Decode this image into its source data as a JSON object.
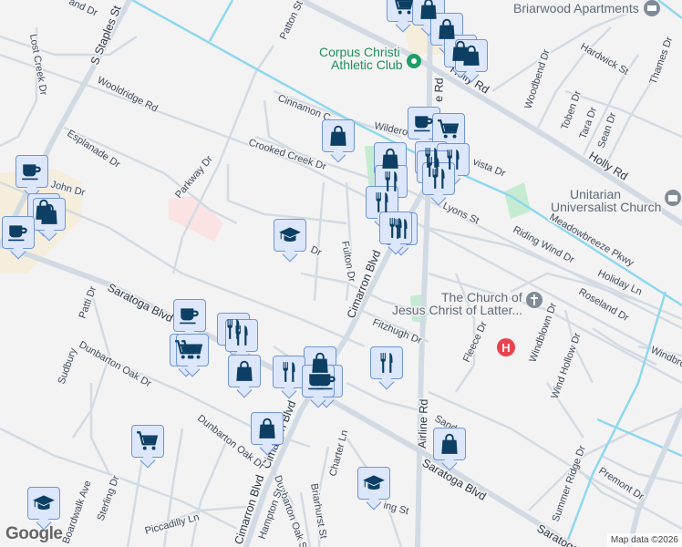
{
  "map": {
    "streets": {
      "s_staples": "S Staples St",
      "lost_creek": "Lost Creek Dr",
      "wooldridge": "Wooldridge Rd",
      "esplanade": "Esplanade Dr",
      "john": "John Dr",
      "parkway": "Parkway Dr",
      "patton": "Patton St",
      "cinnamon": "Cinnamon C",
      "crooked_creek": "Crooked Creek Dr",
      "fulton": "Fulton Dr",
      "cimarron1": "Cimarron Blvd",
      "cimarron2": "Cimarron Blvd",
      "cimarron3": "Cimarron Blvd",
      "saratoga1": "Saratoga Blvd",
      "saratoga2": "Saratoga Blvd",
      "saratoga3": "Saratoga",
      "patti": "Patti Dr",
      "sudbury": "Sudbury",
      "dunbarton1": "Dunbarton Oak Dr",
      "dunbarton2": "Dunbarton Oak Dr",
      "dunbarton3": "Dunbarton Oak St",
      "hampton": "Hampton St",
      "briarhurst": "Briarhurst St",
      "charter": "Charter Ln",
      "boardwalk": "Boardwalk Ave",
      "sterling": "Sterling Dr",
      "piccadilly": "Piccadilly Ln",
      "holly1": "Holly Rd",
      "holly2": "Holly Rd",
      "airline1": "Airline Rd",
      "airline2": "e Rd",
      "woodbend": "Woodbend Dr",
      "hardwick": "Hardwick St",
      "thames": "Thames Dr",
      "toben": "Toben Dr",
      "tara": "Tara Dr",
      "sean": "Sean Dr",
      "wilderock": "Wilderock",
      "vista": "vista Dr",
      "lyons": "Lyons St",
      "riding_wind": "Riding Wind Dr",
      "meadowbreeze": "Meadowbreeze Pkwy",
      "holiday": "Holiday Ln",
      "roseland": "Roseland Dr",
      "fitzhugh": "Fitzhugh Dr",
      "fleece": "Fleece Dr",
      "windblown": "Windblown Dr",
      "wind_hollow": "Wind Hollow Dr",
      "windbrook": "Windbro",
      "sand": "Sand",
      "summer_ridge": "Summer Ridge Dr",
      "premont": "Premont Dr",
      "ing": "ing St",
      "and_dr": "and Dr",
      "dr_short": "Dr"
    },
    "pois": {
      "athletic_club": [
        "Corpus Christi",
        "Athletic Club"
      ],
      "briarwood": "Briarwood Apartments",
      "unitarian": [
        "Unitarian",
        "Universalist Church"
      ],
      "lds": [
        "The Church of",
        "Jesus Christ of Latter..."
      ]
    },
    "hospital_glyph": "H",
    "colors": {
      "marker_fill": "#dde7fb",
      "marker_border": "#6f95d8",
      "icon": "#0c3f63",
      "canal": "#8fd8ee",
      "park": "#c5ecd2",
      "hospital": "#e8434f"
    }
  },
  "footer": {
    "logo": "Google",
    "attribution": "Map data ©2026"
  }
}
